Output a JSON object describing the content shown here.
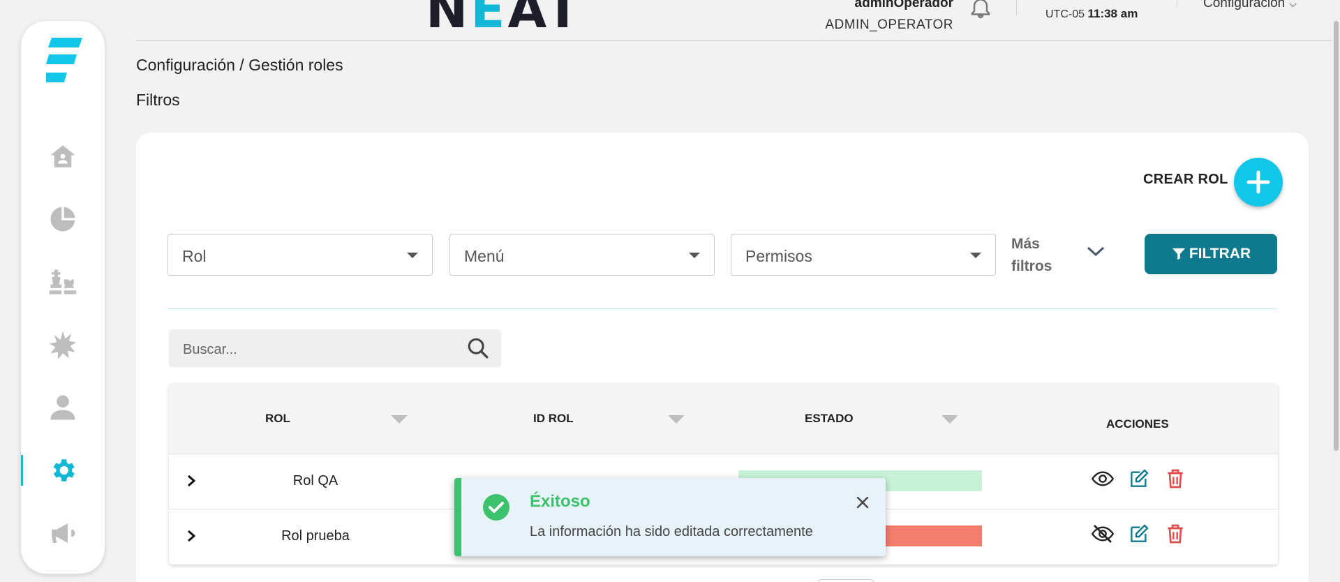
{
  "header": {
    "brand": "NEAT",
    "user_name": "adminOperador",
    "user_role": "ADMIN_OPERATOR",
    "timezone": "UTC-05",
    "time": "11:38 am",
    "config_menu": "Configuración"
  },
  "sidebar": {
    "items": [
      {
        "name": "home",
        "active": false
      },
      {
        "name": "reports",
        "active": false
      },
      {
        "name": "strategy",
        "active": false
      },
      {
        "name": "incidents",
        "active": false
      },
      {
        "name": "users",
        "active": false
      },
      {
        "name": "settings",
        "active": true
      },
      {
        "name": "announcements",
        "active": false
      }
    ]
  },
  "breadcrumb": "Configuración / Gestión roles",
  "section_title": "Filtros",
  "actions": {
    "create_label": "CREAR ROL",
    "filter_label": "FILTRAR",
    "more_filters": "Más filtros"
  },
  "filters": {
    "rol": "Rol",
    "menu": "Menú",
    "permisos": "Permisos"
  },
  "search": {
    "placeholder": "Buscar..."
  },
  "table": {
    "headers": [
      "ROL",
      "ID ROL",
      "ESTADO",
      "ACCIONES"
    ],
    "rows": [
      {
        "rol": "Rol QA",
        "id": "",
        "status_label": "",
        "status_color": "#c8f2d8",
        "visible": true
      },
      {
        "rol": "Rol prueba",
        "id": "",
        "status_label": "",
        "status_color": "#f47e6e",
        "visible": false
      }
    ]
  },
  "toast": {
    "title": "Éxitoso",
    "message": "La información ha sido editada correctamente"
  },
  "colors": {
    "accent": "#12b8d6",
    "primary_button": "#0f7a8e",
    "success": "#3cc16d",
    "danger": "#e24b4b"
  }
}
